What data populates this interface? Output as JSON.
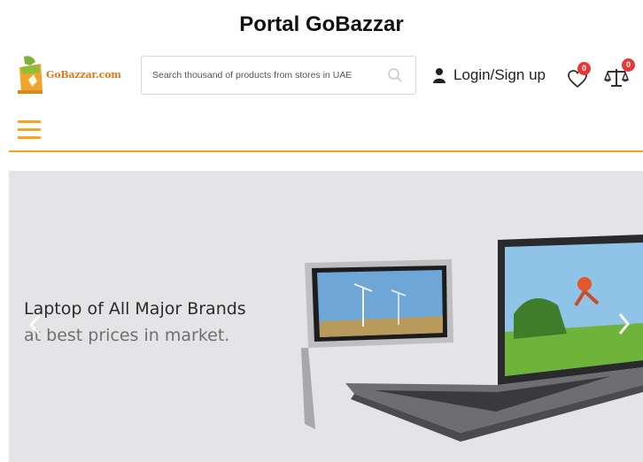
{
  "page": {
    "title": "Portal GoBazzar"
  },
  "header": {
    "logo_text": "GoBazzar.com",
    "search": {
      "placeholder": "Search thousand of products from stores in UAE",
      "value": ""
    },
    "login_label": "Login/Sign up",
    "wishlist_count": "0",
    "compare_count": "0"
  },
  "banner": {
    "heading": "Laptop of All Major Brands",
    "subheading": "at best prices in market."
  },
  "colors": {
    "accent": "#f2a51f",
    "badge": "#e53935",
    "banner_bg": "#e4e4e6"
  },
  "icons": [
    "search-icon",
    "user-icon",
    "heart-icon",
    "scale-icon",
    "menu-icon",
    "chevron-left-icon",
    "chevron-right-icon"
  ]
}
